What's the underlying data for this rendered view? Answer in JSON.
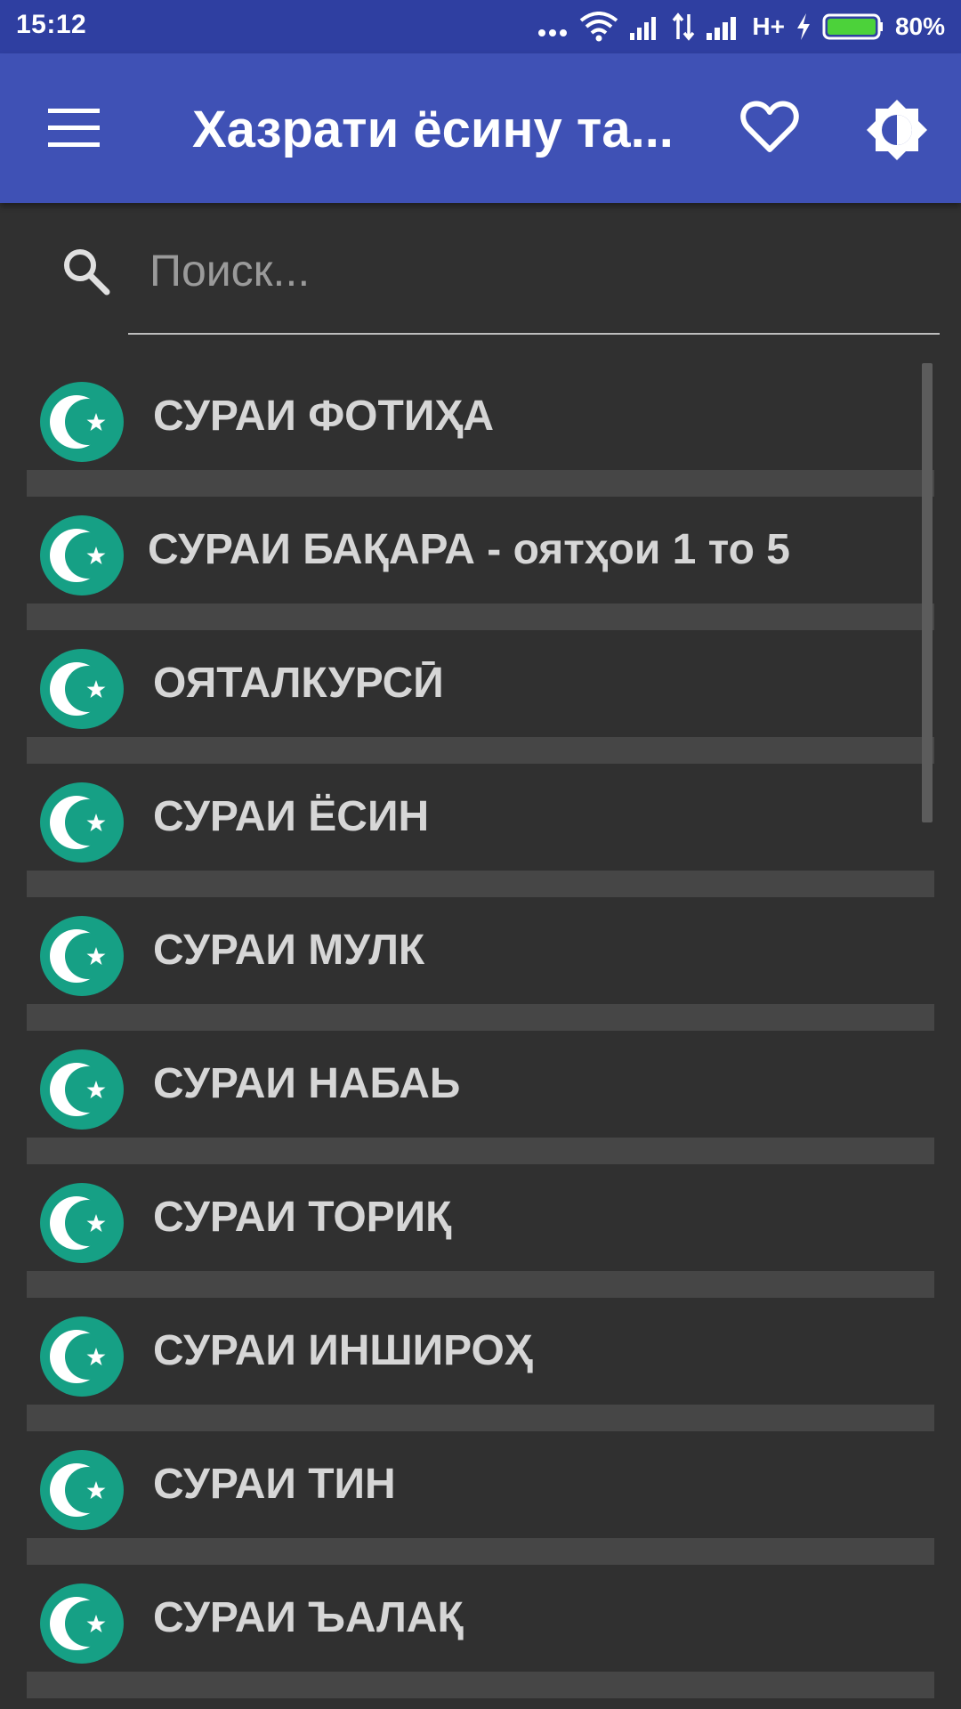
{
  "status_bar": {
    "time": "15:12",
    "network": "H+",
    "battery_percent": "80%",
    "battery_level": 0.8,
    "icons": [
      "more-dots-icon",
      "wifi-icon",
      "signal-icon",
      "data-arrows-icon",
      "signal-icon",
      "charging-icon",
      "battery-icon"
    ]
  },
  "app_bar": {
    "title": "Хазрати ёсину та...",
    "menu_icon": "hamburger-menu-icon",
    "favorite_icon": "heart-icon",
    "theme_icon": "brightness-icon",
    "color": "#3f51b5"
  },
  "search": {
    "placeholder": "Поиск...",
    "value": ""
  },
  "list": {
    "icon": "crescent-star-icon",
    "icon_color": "#16a085",
    "items": [
      {
        "label": "СУРАИ ФОТИҲА"
      },
      {
        "label": "СУРАИ БАҚАРА - оятҳои 1 то 5"
      },
      {
        "label": "ОЯТАЛКУРСӢ"
      },
      {
        "label": "СУРАИ ЁСИН"
      },
      {
        "label": "СУРАИ МУЛК"
      },
      {
        "label": "СУРАИ НАБАЬ"
      },
      {
        "label": "СУРАИ ТОРИҚ"
      },
      {
        "label": "СУРАИ ИНШИРОҲ"
      },
      {
        "label": "СУРАИ ТИН"
      },
      {
        "label": "СУРАИ ЪАЛАҚ"
      }
    ]
  }
}
